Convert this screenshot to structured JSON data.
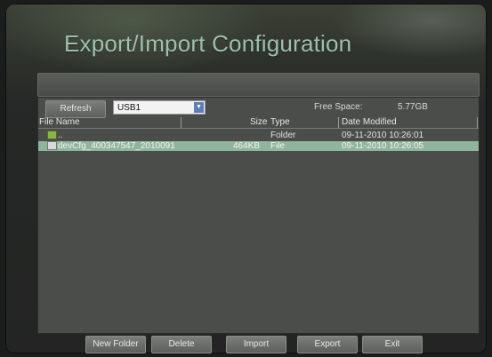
{
  "header": {
    "title": "Export/Import Configuration"
  },
  "toolbar": {
    "refresh_label": "Refresh",
    "device_selected": "USB1",
    "free_space_label": "Free Space:",
    "free_space_value": "5.77GB"
  },
  "table": {
    "columns": [
      "File Name",
      "Size",
      "Type",
      "Date Modified"
    ],
    "rows": [
      {
        "name": "..",
        "size": "",
        "type": "Folder",
        "date": "09-11-2010 10:26:01",
        "icon": "folder-icon"
      },
      {
        "name": "devCfg_400347547_2010091",
        "size": "464KB",
        "type": "File",
        "date": "09-11-2010 10:26:05",
        "icon": "file-icon"
      }
    ]
  },
  "footer": {
    "new_folder": "New Folder",
    "delete": "Delete",
    "import": "Import",
    "export": "Export",
    "exit": "Exit"
  },
  "colors": {
    "title": "#9fc0ad",
    "selection": "#8fb59c",
    "dropdown_arrow": "#5b7fb8"
  }
}
